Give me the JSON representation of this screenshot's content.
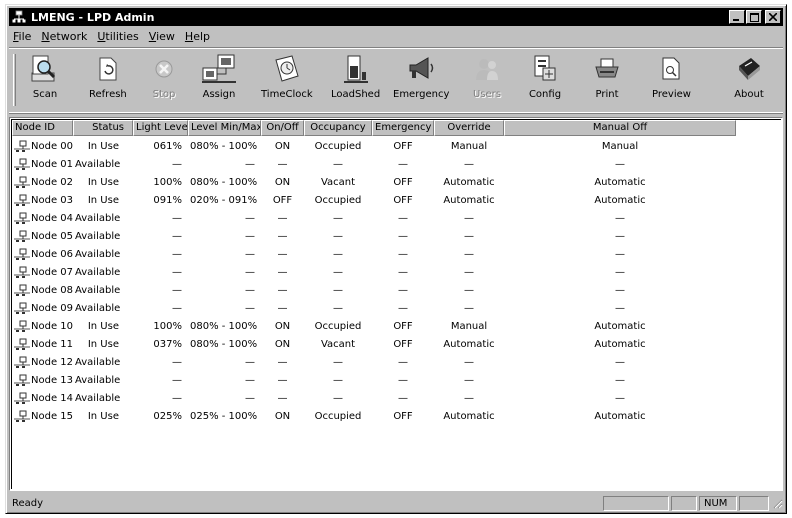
{
  "window": {
    "title": "LMENG - LPD Admin"
  },
  "menu": [
    {
      "label": "File",
      "key": "F",
      "rest": "ile"
    },
    {
      "label": "Network",
      "key": "N",
      "rest": "etwork"
    },
    {
      "label": "Utilities",
      "key": "U",
      "rest": "tilities"
    },
    {
      "label": "View",
      "key": "V",
      "rest": "iew"
    },
    {
      "label": "Help",
      "key": "H",
      "rest": "elp"
    }
  ],
  "toolbar": {
    "scan": "Scan",
    "refresh": "Refresh",
    "stop": "Stop",
    "assign": "Assign",
    "timeclock": "TimeClock",
    "loadshed": "LoadShed",
    "emergency": "Emergency",
    "users": "Users",
    "config": "Config",
    "print": "Print",
    "preview": "Preview",
    "about": "About"
  },
  "columns": {
    "node_id": "Node ID",
    "status": "Status",
    "light_level": "Light Level",
    "level_minmax": "Level Min/Max",
    "on_off": "On/Off",
    "occupancy": "Occupancy",
    "emergency": "Emergency",
    "override": "Override",
    "manual_off": "Manual Off"
  },
  "rows": [
    {
      "node": "Node 00",
      "status": "In Use",
      "light": "061%",
      "minmax": "080% - 100%",
      "onoff": "ON",
      "occ": "Occupied",
      "emer": "OFF",
      "ovr": "Manual",
      "man": "Manual"
    },
    {
      "node": "Node 01",
      "status": "Available",
      "light": "—",
      "minmax": "—",
      "onoff": "—",
      "occ": "—",
      "emer": "—",
      "ovr": "—",
      "man": "—"
    },
    {
      "node": "Node 02",
      "status": "In Use",
      "light": "100%",
      "minmax": "080% - 100%",
      "onoff": "ON",
      "occ": "Vacant",
      "emer": "OFF",
      "ovr": "Automatic",
      "man": "Automatic"
    },
    {
      "node": "Node 03",
      "status": "In Use",
      "light": "091%",
      "minmax": "020% - 091%",
      "onoff": "OFF",
      "occ": "Occupied",
      "emer": "OFF",
      "ovr": "Automatic",
      "man": "Automatic"
    },
    {
      "node": "Node 04",
      "status": "Available",
      "light": "—",
      "minmax": "—",
      "onoff": "—",
      "occ": "—",
      "emer": "—",
      "ovr": "—",
      "man": "—"
    },
    {
      "node": "Node 05",
      "status": "Available",
      "light": "—",
      "minmax": "—",
      "onoff": "—",
      "occ": "—",
      "emer": "—",
      "ovr": "—",
      "man": "—"
    },
    {
      "node": "Node 06",
      "status": "Available",
      "light": "—",
      "minmax": "—",
      "onoff": "—",
      "occ": "—",
      "emer": "—",
      "ovr": "—",
      "man": "—"
    },
    {
      "node": "Node 07",
      "status": "Available",
      "light": "—",
      "minmax": "—",
      "onoff": "—",
      "occ": "—",
      "emer": "—",
      "ovr": "—",
      "man": "—"
    },
    {
      "node": "Node 08",
      "status": "Available",
      "light": "—",
      "minmax": "—",
      "onoff": "—",
      "occ": "—",
      "emer": "—",
      "ovr": "—",
      "man": "—"
    },
    {
      "node": "Node 09",
      "status": "Available",
      "light": "—",
      "minmax": "—",
      "onoff": "—",
      "occ": "—",
      "emer": "—",
      "ovr": "—",
      "man": "—"
    },
    {
      "node": "Node 10",
      "status": "In Use",
      "light": "100%",
      "minmax": "080% - 100%",
      "onoff": "ON",
      "occ": "Occupied",
      "emer": "OFF",
      "ovr": "Manual",
      "man": "Automatic"
    },
    {
      "node": "Node 11",
      "status": "In Use",
      "light": "037%",
      "minmax": "080% - 100%",
      "onoff": "ON",
      "occ": "Vacant",
      "emer": "OFF",
      "ovr": "Automatic",
      "man": "Automatic"
    },
    {
      "node": "Node 12",
      "status": "Available",
      "light": "—",
      "minmax": "—",
      "onoff": "—",
      "occ": "—",
      "emer": "—",
      "ovr": "—",
      "man": "—"
    },
    {
      "node": "Node 13",
      "status": "Available",
      "light": "—",
      "minmax": "—",
      "onoff": "—",
      "occ": "—",
      "emer": "—",
      "ovr": "—",
      "man": "—"
    },
    {
      "node": "Node 14",
      "status": "Available",
      "light": "—",
      "minmax": "—",
      "onoff": "—",
      "occ": "—",
      "emer": "—",
      "ovr": "—",
      "man": "—"
    },
    {
      "node": "Node 15",
      "status": "In Use",
      "light": "025%",
      "minmax": "025% - 100%",
      "onoff": "ON",
      "occ": "Occupied",
      "emer": "OFF",
      "ovr": "Automatic",
      "man": "Automatic"
    }
  ],
  "statusbar": {
    "text": "Ready",
    "num": "NUM"
  }
}
